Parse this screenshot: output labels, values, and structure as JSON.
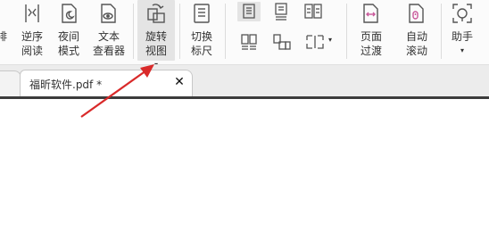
{
  "ribbon": {
    "partial_label": "排",
    "reverse_read": {
      "line1": "逆序",
      "line2": "阅读",
      "icon": "reverse-reading-icon"
    },
    "night_mode": {
      "line1": "夜间",
      "line2": "模式",
      "icon": "night-mode-icon"
    },
    "text_viewer": {
      "line1": "文本",
      "line2": "查看器",
      "icon": "text-viewer-icon"
    },
    "rotate_view": {
      "line1": "旋转",
      "line2": "视图",
      "caret": "▾",
      "icon": "rotate-view-icon"
    },
    "toggle_ruler": {
      "line1": "切换",
      "line2": "标尺",
      "icon": "ruler-icon"
    },
    "page_layout": {
      "icons": [
        "single-page-icon",
        "continuous-page-icon",
        "facing-page-icon",
        "continuous-facing-icon",
        "cover-page-icon",
        "split-view-icon"
      ],
      "split_caret": "▾"
    },
    "page_transition": {
      "line1": "页面",
      "line2": "过渡",
      "icon": "page-transition-icon"
    },
    "auto_scroll": {
      "line1": "自动",
      "line2": "滚动",
      "icon": "auto-scroll-icon"
    },
    "assistant": {
      "line1": "助手",
      "caret": "▾",
      "icon": "assistant-icon"
    }
  },
  "tabs": {
    "active_title": "福昕软件.pdf *",
    "close_glyph": "✕"
  },
  "annotation": {
    "color": "#d92a2a",
    "icon": "red-arrow"
  }
}
